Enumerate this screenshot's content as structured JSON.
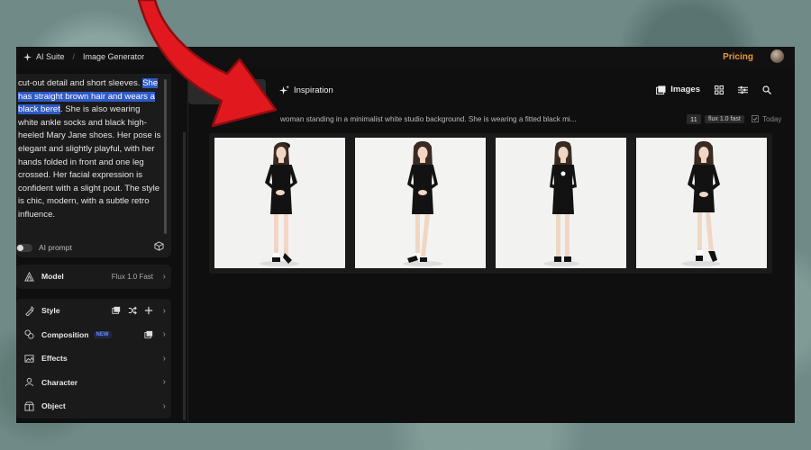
{
  "topbar": {
    "suite_label": "AI Suite",
    "separator": "/",
    "page_label": "Image Generator",
    "pricing_label": "Pricing"
  },
  "prompt": {
    "text_before": "cut-out detail and short sleeves. ",
    "text_highlight": "She has straight brown hair and wears a black beret",
    "text_after": ". She is also wearing white ankle socks and black high-heeled Mary Jane shoes. Her pose is elegant and slightly playful, with her hands folded in front and one leg crossed. Her facial expression is confident with a slight pout. The style is chic, modern, with a subtle retro influence.",
    "ai_prompt_label": "AI prompt"
  },
  "settings": {
    "model_label": "Model",
    "model_value": "Flux 1.0 Fast",
    "style_label": "Style",
    "composition_label": "Composition",
    "composition_badge": "NEW",
    "effects_label": "Effects",
    "character_label": "Character",
    "object_label": "Object"
  },
  "main": {
    "inspiration_label": "Inspiration",
    "images_label": "Images"
  },
  "generation": {
    "prompt_snippet": "woman standing in a minimalist white studio background. She is wearing a fitted black mi...",
    "count": "11",
    "model_tag": "flux 1.0 fast",
    "date_label": "Today"
  },
  "icons": {
    "suite": "sparkle-icon",
    "inspiration": "sparkle-icon",
    "images": "images-icon",
    "grid": "grid-icon",
    "filters": "sliders-icon",
    "search": "search-icon"
  },
  "colors": {
    "accent_pricing": "#e99a3d",
    "highlight": "#2f5ac6",
    "arrow": "#e1191f"
  }
}
